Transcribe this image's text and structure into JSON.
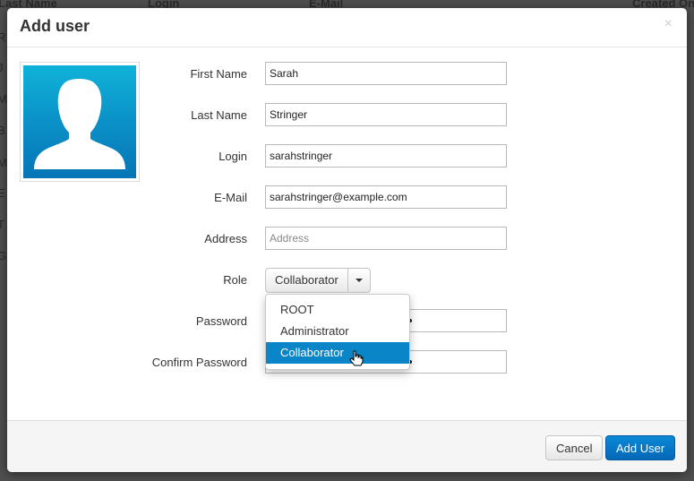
{
  "background": {
    "headers": [
      "Last Name",
      "Login",
      "E-Mail",
      "Created On"
    ],
    "row_initials": [
      "R",
      "J",
      "M",
      "B",
      "M",
      "E",
      "T",
      "G"
    ]
  },
  "modal": {
    "title": "Add user",
    "close_glyph": "×"
  },
  "avatar": {
    "icon": "user-silhouette-icon",
    "bg_color": "#0a8ec6"
  },
  "form": {
    "first_name": {
      "label": "First Name",
      "value": "Sarah"
    },
    "last_name": {
      "label": "Last Name",
      "value": "Stringer"
    },
    "login": {
      "label": "Login",
      "value": "sarahstringer"
    },
    "email": {
      "label": "E-Mail",
      "value": "sarahstringer@example.com"
    },
    "address": {
      "label": "Address",
      "value": "",
      "placeholder": "Address"
    },
    "role": {
      "label": "Role",
      "selected": "Collaborator",
      "options": [
        "ROOT",
        "Administrator",
        "Collaborator"
      ],
      "highlighted": "Collaborator"
    },
    "password": {
      "label": "Password"
    },
    "confirm_password": {
      "label": "Confirm Password"
    }
  },
  "footer": {
    "cancel_label": "Cancel",
    "add_label": "Add User"
  },
  "colors": {
    "primary": "#0567b8",
    "highlight": "#0a85c8"
  }
}
